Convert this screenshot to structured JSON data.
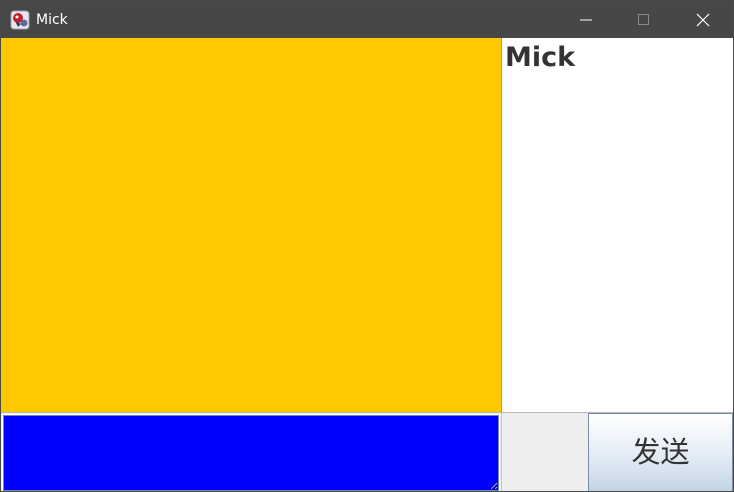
{
  "window": {
    "title": "Mick",
    "app_icon": "java-app-icon",
    "controls": {
      "minimize_icon": "minimize-icon",
      "maximize_icon": "maximize-icon",
      "close_icon": "close-icon"
    }
  },
  "main": {
    "canvas_color": "#ffc800"
  },
  "user_list": {
    "items": [
      "Mick"
    ]
  },
  "compose": {
    "input_value": "",
    "input_color": "#0000ff",
    "send_label": "发送"
  }
}
